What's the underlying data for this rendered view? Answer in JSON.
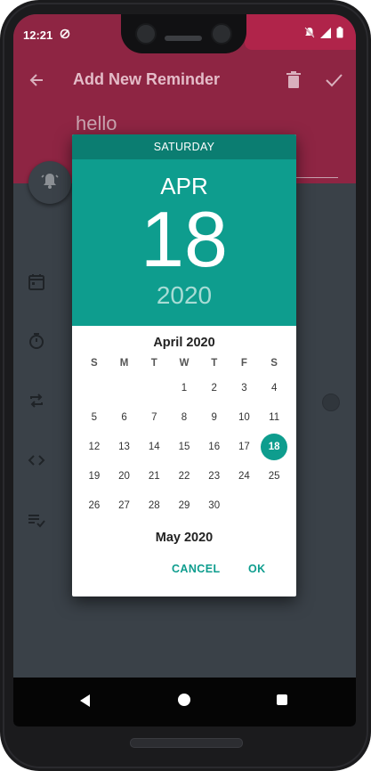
{
  "status_bar": {
    "time": "12:21",
    "sync_icon": "sync-off-icon",
    "icons": [
      "bell-off-icon",
      "signal-icon",
      "battery-icon"
    ]
  },
  "app_bar": {
    "title": "Add New Reminder",
    "back_icon": "arrow-back-icon",
    "delete_icon": "delete-icon",
    "save_icon": "check-icon"
  },
  "form": {
    "title_value": "hello",
    "fab_icon": "alarm-icon",
    "side_icons": [
      "calendar-icon",
      "timer-icon",
      "repeat-icon",
      "code-icon",
      "checklist-icon"
    ]
  },
  "date_picker": {
    "weekday": "SATURDAY",
    "month": "APR",
    "day": "18",
    "year": "2020",
    "calendar_title": "April 2020",
    "weekday_headers": [
      "S",
      "M",
      "T",
      "W",
      "T",
      "F",
      "S"
    ],
    "leading_blanks": 3,
    "days": [
      "1",
      "2",
      "3",
      "4",
      "5",
      "6",
      "7",
      "8",
      "9",
      "10",
      "11",
      "12",
      "13",
      "14",
      "15",
      "16",
      "17",
      "18",
      "19",
      "20",
      "21",
      "22",
      "23",
      "24",
      "25",
      "26",
      "27",
      "28",
      "29",
      "30"
    ],
    "selected_day": "18",
    "next_month_title": "May 2020",
    "cancel_label": "CANCEL",
    "ok_label": "OK"
  },
  "nav_bar": {
    "icons": [
      "nav-back-icon",
      "nav-home-icon",
      "nav-recents-icon"
    ]
  },
  "colors": {
    "header": "#8e2543",
    "accent": "#0e9d8e",
    "accent_dark": "#0b7d71",
    "background": "#3a4148"
  }
}
